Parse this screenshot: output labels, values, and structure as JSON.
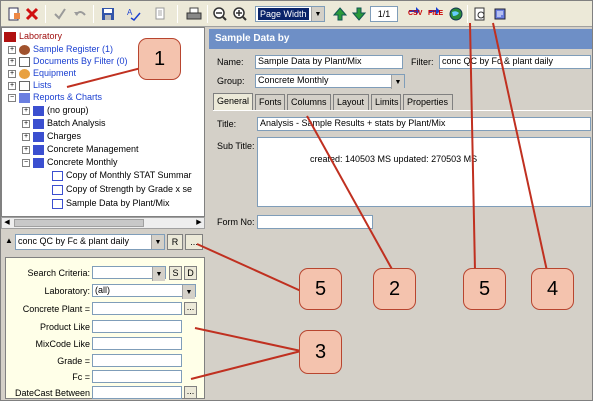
{
  "toolbar": {
    "zoom_value": "Page Width",
    "page_indicator": "1/1",
    "csv_label": "CSV",
    "file_label": "FILE"
  },
  "tree": {
    "root": "Laboratory",
    "items": [
      {
        "label": "Sample Register (1)"
      },
      {
        "label": "Documents By Filter (0)"
      },
      {
        "label": "Equipment"
      },
      {
        "label": "Lists"
      },
      {
        "label": "Reports & Charts"
      },
      {
        "label": "(no group)"
      },
      {
        "label": "Batch Analysis"
      },
      {
        "label": "Charges"
      },
      {
        "label": "Concrete Management"
      },
      {
        "label": "Concrete Monthly"
      },
      {
        "label": "Copy of Monthly STAT Summar"
      },
      {
        "label": "Copy of Strength by Grade x se"
      },
      {
        "label": "Sample Data  by Plant/Mix"
      }
    ]
  },
  "filter": {
    "selected": "conc QC by Fc & plant daily",
    "r_label": "R",
    "more_label": "..."
  },
  "criteria": {
    "rows": [
      {
        "label": "Search Criteria:",
        "value": ""
      },
      {
        "label": "Laboratory:",
        "value": "(all)"
      },
      {
        "label": "Concrete Plant =",
        "value": ""
      },
      {
        "label": "Product Like",
        "value": ""
      },
      {
        "label": "MixCode Like",
        "value": ""
      },
      {
        "label": "Grade =",
        "value": ""
      },
      {
        "label": "Fc =",
        "value": ""
      },
      {
        "label": "DateCast Between",
        "value": ""
      }
    ],
    "s_label": "S",
    "d_label": "D"
  },
  "report": {
    "header": "Sample Data  by",
    "name_label": "Name:",
    "name_value": "Sample Data  by Plant/Mix",
    "filter_label": "Filter:",
    "filter_value": "conc QC by Fc & plant daily",
    "group_label": "Group:",
    "group_value": "Concrete Monthly",
    "tabs": [
      "General",
      "Fonts",
      "Columns",
      "Layout",
      "Limits",
      "Properties"
    ],
    "title_label": "Title:",
    "title_value": "Analysis - Sample Results + stats by Plant/Mix",
    "subtitle_label": "Sub Title:",
    "subtitle_value": "created: 140503 MS   updated: 270503 MS",
    "formno_label": "Form No:",
    "formno_value": ""
  },
  "callouts": [
    "1",
    "2",
    "3",
    "4",
    "5",
    "5"
  ]
}
